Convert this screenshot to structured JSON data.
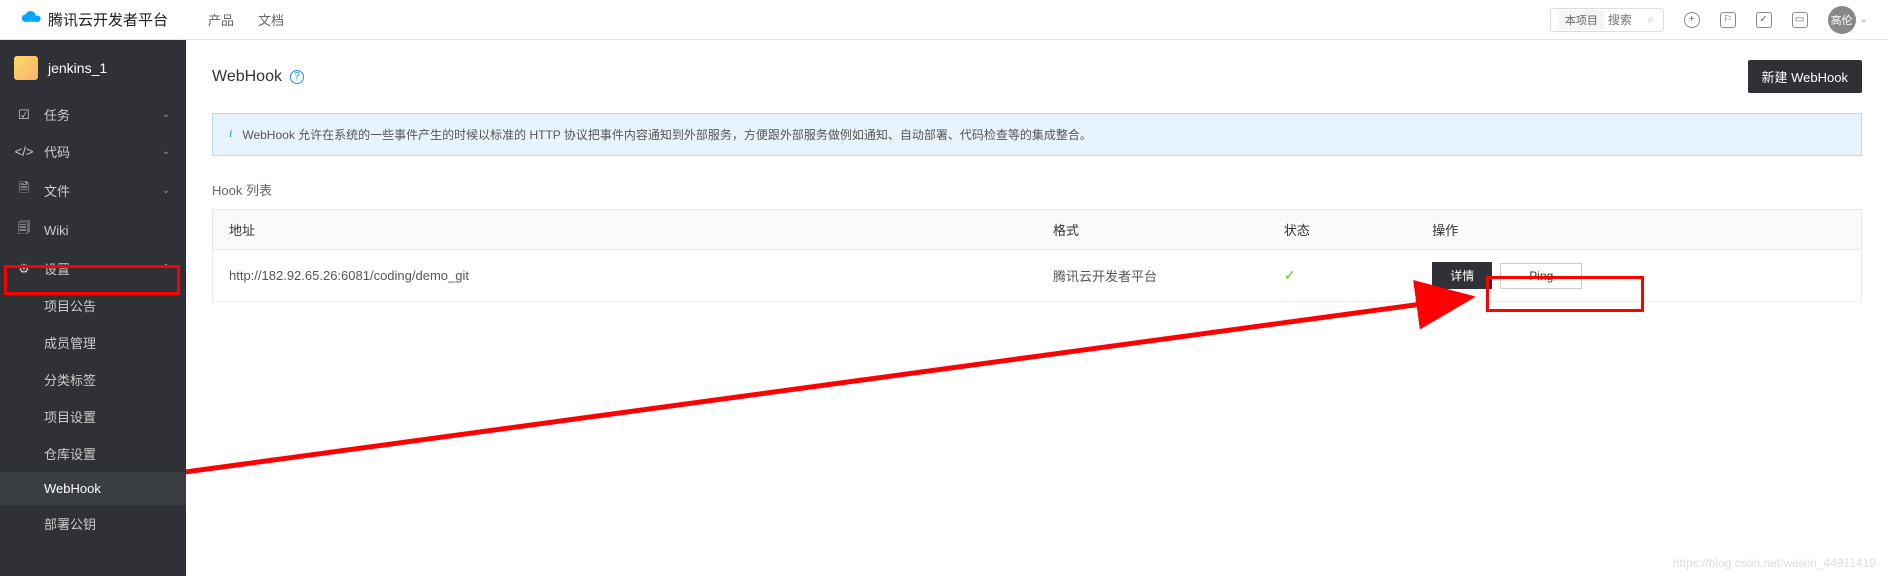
{
  "header": {
    "platform_name": "腾讯云开发者平台",
    "nav": {
      "products": "产品",
      "docs": "文档"
    },
    "search": {
      "scope": "本项目",
      "placeholder": "搜索"
    },
    "user_initials": "高伦"
  },
  "sidebar": {
    "project_name": "jenkins_1",
    "items": {
      "tasks": "任务",
      "code": "代码",
      "files": "文件",
      "wiki": "Wiki",
      "settings": "设置"
    },
    "settings_children": {
      "announcement": "项目公告",
      "members": "成员管理",
      "labels": "分类标签",
      "project_settings": "项目设置",
      "repo_settings": "仓库设置",
      "webhook": "WebHook",
      "deploy_keys": "部署公钥"
    }
  },
  "page": {
    "title": "WebHook",
    "new_button": "新建 WebHook",
    "info_text": "WebHook 允许在系统的一些事件产生的时候以标准的 HTTP 协议把事件内容通知到外部服务，方便跟外部服务做例如通知、自动部署、代码检查等的集成整合。",
    "list_title": "Hook 列表",
    "columns": {
      "url": "地址",
      "format": "格式",
      "status": "状态",
      "action": "操作"
    },
    "rows": [
      {
        "url": "http://182.92.65.26:6081/coding/demo_git",
        "format": "腾讯云开发者平台",
        "status_ok": true,
        "detail_label": "详情",
        "ping_label": "Ping"
      }
    ],
    "watermark": "https://blog.csdn.net/weixin_44911419"
  }
}
